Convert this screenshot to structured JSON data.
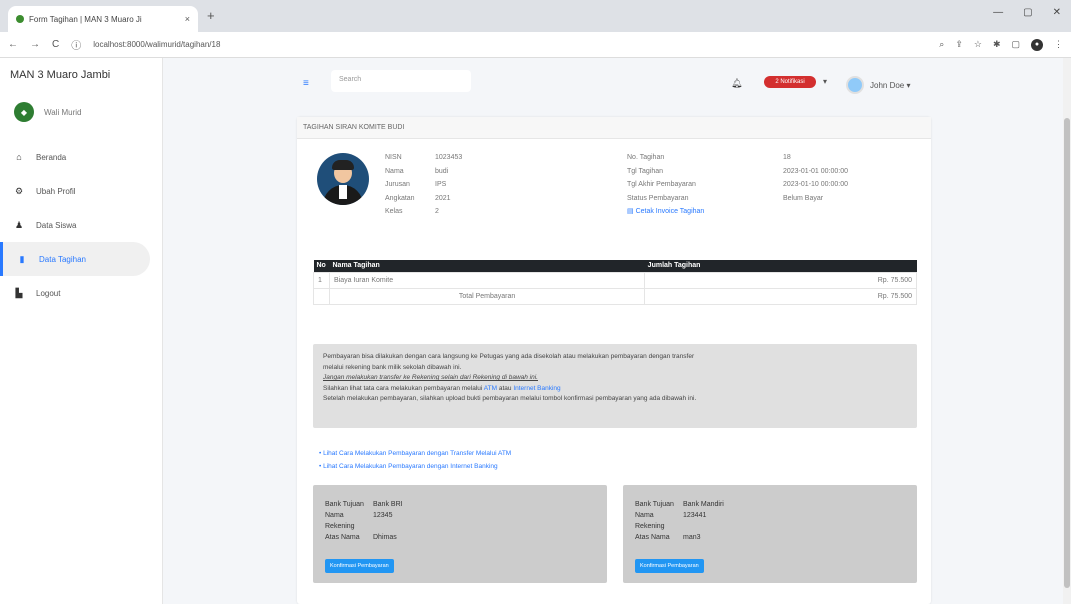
{
  "browser": {
    "tab_title": "Form Tagihan | MAN 3 Muaro Ji",
    "tab_close": "×",
    "new_tab": "+",
    "url": "localhost:8000/walimurid/tagihan/18",
    "win_min": "—",
    "win_max": "▢",
    "win_close": "✕"
  },
  "sidebar": {
    "brand": "MAN 3 Muaro Jambi",
    "user": "Wali Murid",
    "items": [
      {
        "label": "Beranda",
        "icon": "home-icon"
      },
      {
        "label": "Ubah Profil",
        "icon": "gear-icon"
      },
      {
        "label": "Data Siswa",
        "icon": "user-icon"
      },
      {
        "label": "Data Tagihan",
        "icon": "file-icon"
      },
      {
        "label": "Logout",
        "icon": "logout-icon"
      }
    ]
  },
  "topbar": {
    "search_placeholder": "Search",
    "badge": "2 Notifikasi",
    "user_name": "John Doe ▾"
  },
  "card": {
    "header": "TAGIHAN SIRAN KOMITE BUDI",
    "student": [
      {
        "k": "NISN",
        "v": "1023453"
      },
      {
        "k": "Nama",
        "v": "budi"
      },
      {
        "k": "Jurusan",
        "v": "IPS"
      },
      {
        "k": "Angkatan",
        "v": "2021"
      },
      {
        "k": "Kelas",
        "v": "2"
      }
    ],
    "bill": [
      {
        "k": "No. Tagihan",
        "v": "18"
      },
      {
        "k": "Tgl Tagihan",
        "v": "2023-01-01 00:00:00"
      },
      {
        "k": "Tgl Akhir Pembayaran",
        "v": "2023-01-10 00:00:00"
      },
      {
        "k": "Status Pembayaran",
        "v": "Belum Bayar"
      }
    ],
    "invoice_link": "Cetak Invoice Tagihan",
    "table": {
      "headers": [
        "No",
        "Nama Tagihan",
        "Jumlah Tagihan"
      ],
      "rows": [
        {
          "no": "1",
          "name": "Biaya Iuran Komite",
          "amount": "Rp. 75.500"
        }
      ],
      "total_label": "Total Pembayaran",
      "total_value": "Rp. 75.500"
    },
    "notice": {
      "line1": "Pembayaran bisa dilakukan dengan cara langsung ke Petugas yang ada disekolah atau melakukan pembayaran dengan transfer",
      "line2": "melalui rekening bank milik sekolah dibawah ini.",
      "line3": "Jangan melakukan transfer ke Rekening selain dari Rekening di bawah ini.",
      "line4a": "Silahkan lihat tata cara melakukan pembayaran melalui",
      "atm": "ATM",
      "atau": "atau",
      "ib": "Internet Banking",
      "line5": "Setelah melakukan pembayaran, silahkan upload bukti pembayaran melalui tombol konfirmasi pembayaran yang ada dibawah ini."
    },
    "links": [
      "Lihat Cara Melakukan Pembayaran dengan Transfer Melalui ATM",
      "Lihat Cara Melakukan Pembayaran dengan Internet Banking"
    ],
    "banks": [
      {
        "k1": "Bank Tujuan",
        "v1": "Bank BRI",
        "k2": "Nama Rekening",
        "v2": "12345",
        "k3": "Atas Nama",
        "v3": "Dhimas"
      },
      {
        "k1": "Bank Tujuan",
        "v1": "Bank Mandiri",
        "k2": "Nama Rekening",
        "v2": "123441",
        "k3": "Atas Nama",
        "v3": "man3"
      }
    ],
    "confirm_label": "Konfirmasi Pembayaran"
  }
}
